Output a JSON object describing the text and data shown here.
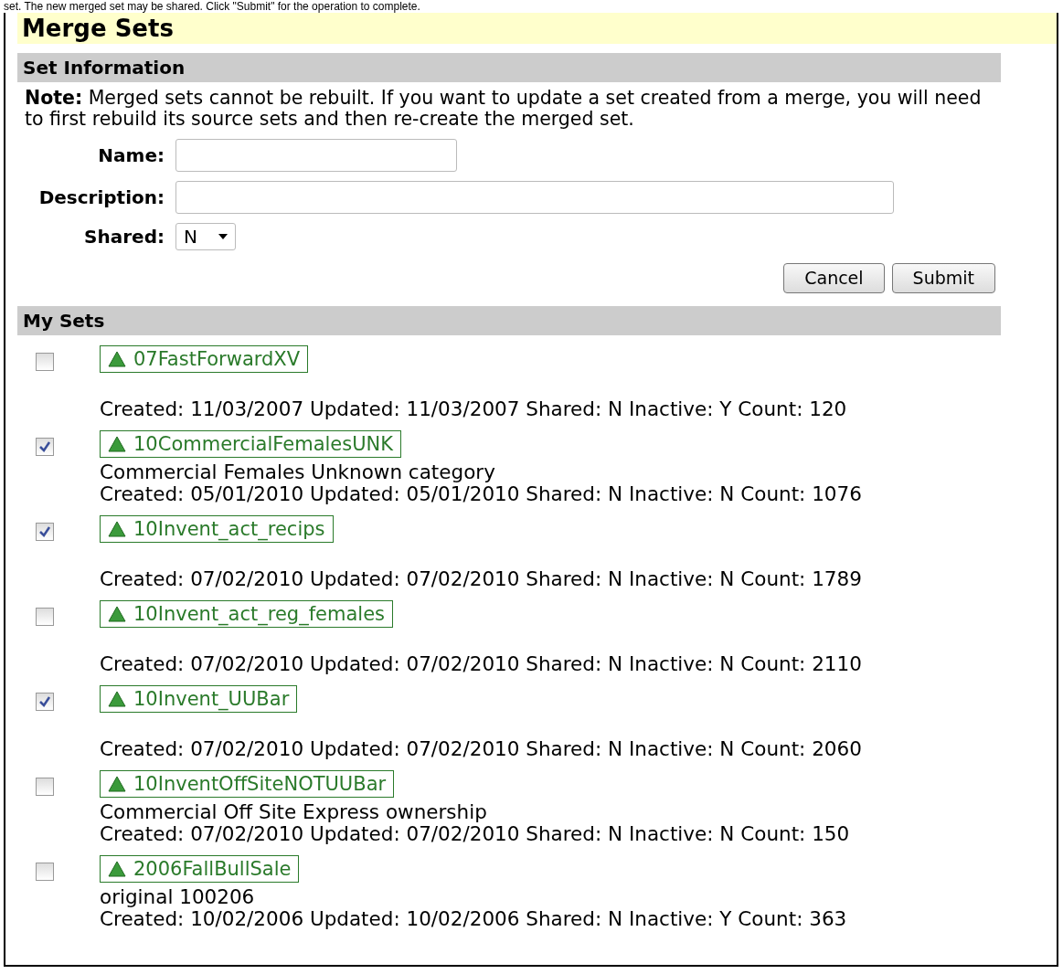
{
  "intro_text": "set. The new merged set may be shared. Click \"Submit\" for the operation to complete.",
  "title": "Merge Sets",
  "set_information": {
    "heading": "Set Information",
    "note": "**Note:** Merged sets cannot be rebuilt. If you want to update a set created from a merge, you will need to first rebuild its source sets and then re-create the merged set.",
    "fields": [
      {
        "kind": "text",
        "label": "Name:"
      },
      {
        "kind": "wide",
        "label": "Description:"
      },
      {
        "kind": "select",
        "label": "Shared:",
        "value": "N"
      }
    ],
    "buttons": [
      "Cancel",
      "Submit"
    ]
  },
  "my_sets": {
    "heading": "My Sets",
    "items": [
      {
        "name": "07FastForwardXV",
        "checked": false,
        "meta": "Created: 11/03/2007 Updated: 11/03/2007 Shared: N Inactive: Y Count: 120"
      },
      {
        "name": "10CommercialFemalesUNK",
        "checked": true,
        "description": "Commercial Females Unknown category",
        "meta": "Created: 05/01/2010 Updated: 05/01/2010 Shared: N Inactive: N Count: 1076"
      },
      {
        "name": "10Invent_act_recips",
        "checked": true,
        "meta": "Created: 07/02/2010 Updated: 07/02/2010 Shared: N Inactive: N Count: 1789"
      },
      {
        "name": "10Invent_act_reg_females",
        "checked": false,
        "meta": "Created: 07/02/2010 Updated: 07/02/2010 Shared: N Inactive: N Count: 2110"
      },
      {
        "name": "10Invent_UUBar",
        "checked": true,
        "meta": "Created: 07/02/2010 Updated: 07/02/2010 Shared: N Inactive: N Count: 2060"
      },
      {
        "name": "10InventOffSiteNOTUUBar",
        "checked": false,
        "description": "Commercial Off Site Express ownership",
        "meta": "Created: 07/02/2010 Updated: 07/02/2010 Shared: N Inactive: N Count: 150"
      },
      {
        "name": "2006FallBullSale",
        "checked": false,
        "description": "original 100206",
        "meta": "Created: 10/02/2006 Updated: 10/02/2006 Shared: N Inactive: Y Count: 363"
      }
    ]
  }
}
